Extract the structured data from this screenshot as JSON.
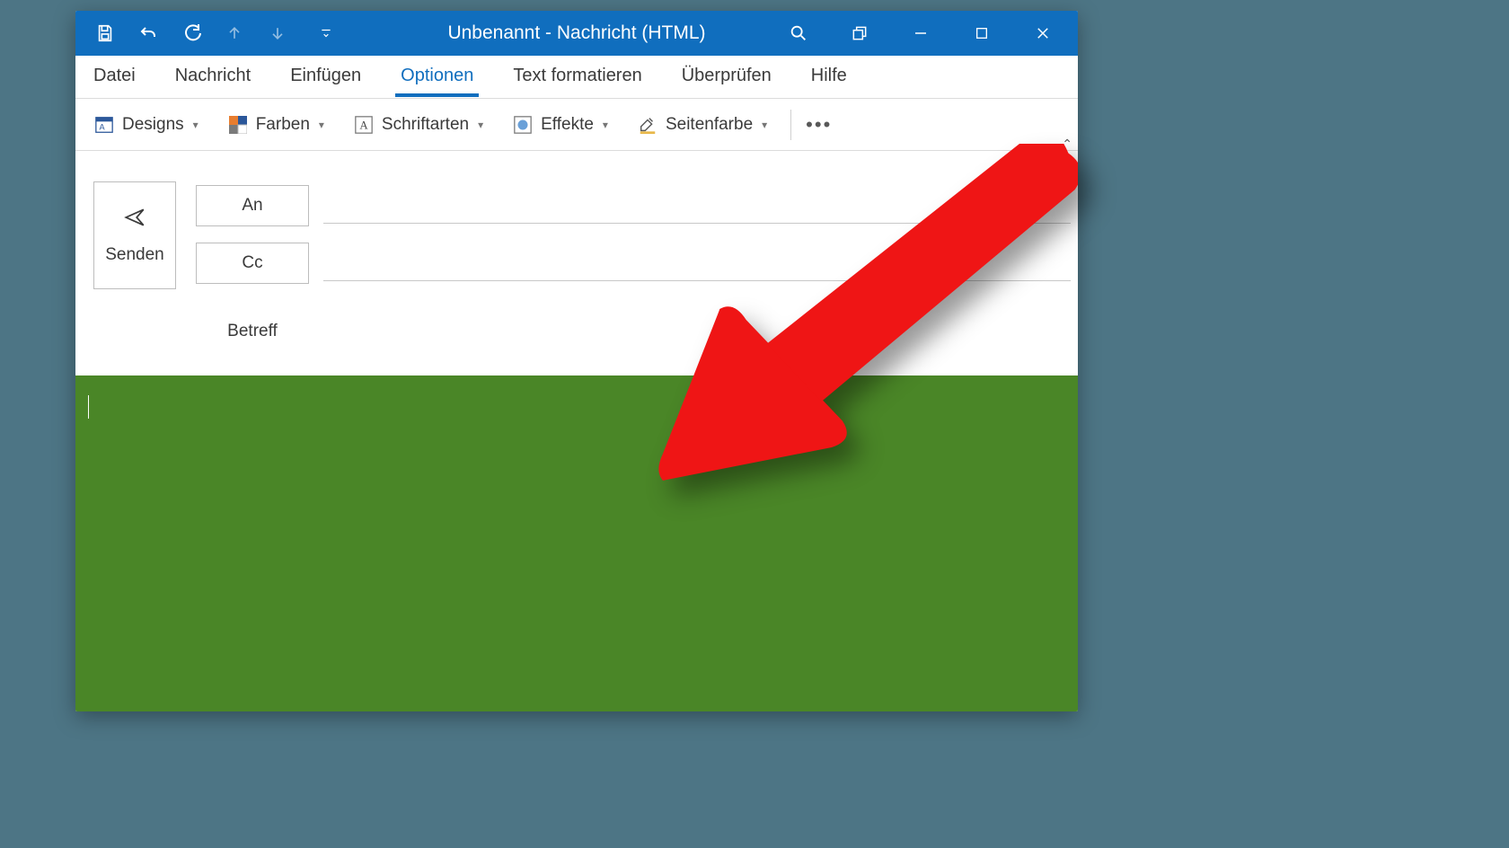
{
  "titlebar": {
    "title": "Unbenannt  -  Nachricht (HTML)"
  },
  "tabs": {
    "file": "Datei",
    "message": "Nachricht",
    "insert": "Einfügen",
    "options": "Optionen",
    "format_text": "Text formatieren",
    "review": "Überprüfen",
    "help": "Hilfe"
  },
  "ribbon": {
    "designs": "Designs",
    "colors": "Farben",
    "fonts": "Schriftarten",
    "effects": "Effekte",
    "page_color": "Seitenfarbe"
  },
  "compose": {
    "send": "Senden",
    "to": "An",
    "cc": "Cc",
    "subject_label": "Betreff",
    "to_value": "",
    "cc_value": "",
    "subject_value": ""
  },
  "colors": {
    "accent": "#106ebe",
    "body_bg": "#4a8627",
    "arrow": "#ef1515"
  }
}
